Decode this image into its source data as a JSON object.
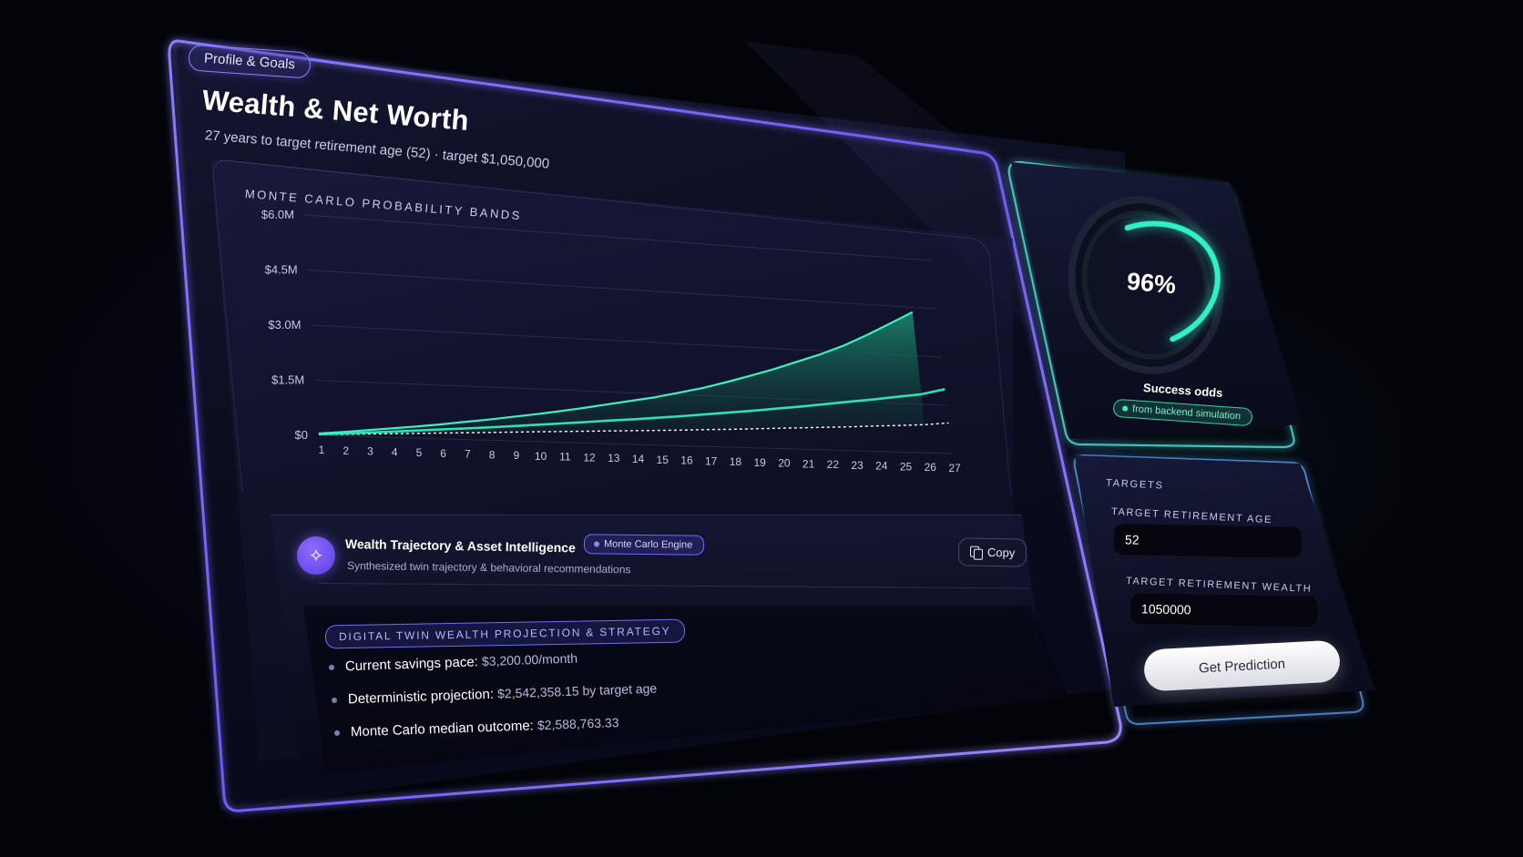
{
  "header": {
    "section_pill": "Profile & Goals",
    "title": "Wealth & Net Worth",
    "subtitle": "27 years to target retirement age (52) · target $1,050,000"
  },
  "chart_data": {
    "type": "area",
    "title": "Monte Carlo Probability Bands",
    "xlabel": "",
    "ylabel": "",
    "x": [
      1,
      2,
      3,
      4,
      5,
      6,
      7,
      8,
      9,
      10,
      11,
      12,
      13,
      14,
      15,
      16,
      17,
      18,
      19,
      20,
      21,
      22,
      23,
      24,
      25,
      26,
      27
    ],
    "y_tick_labels": [
      "$0",
      "$1.5M",
      "$3.0M",
      "$4.5M",
      "$6.0M"
    ],
    "ylim": [
      0,
      6000000
    ],
    "grid": true,
    "series": [
      {
        "values": [
          50000,
          110000,
          180000,
          250000,
          320000,
          400000,
          490000,
          580000,
          680000,
          780000,
          890000,
          1010000,
          1140000,
          1270000,
          1400000,
          1560000,
          1730000,
          1930000,
          2150000,
          2380000,
          2640000,
          2900000,
          3200000,
          3560000,
          3950000,
          4350000
        ]
      },
      {
        "values": [
          30000,
          70000,
          110000,
          160000,
          210000,
          260000,
          310000,
          360000,
          420000,
          480000,
          540000,
          600000,
          670000,
          730000,
          800000,
          870000,
          950000,
          1030000,
          1110000,
          1200000,
          1290000,
          1390000,
          1490000,
          1590000,
          1700000,
          1810000,
          2000000
        ]
      },
      {
        "values": [
          20000,
          45000,
          75000,
          100000,
          130000,
          160000,
          190000,
          220000,
          250000,
          280000,
          310000,
          340000,
          370000,
          400000,
          430000,
          460000,
          500000,
          530000,
          570000,
          610000,
          650000,
          690000,
          730000,
          780000,
          820000,
          870000,
          950000
        ]
      }
    ],
    "colors": {
      "upper": "#3df0c0",
      "median": "#2fe0b4",
      "baseline": "#ffffff",
      "fill": "#12634f"
    }
  },
  "insight": {
    "title": "Wealth Trajectory & Asset Intelligence",
    "badge": "Monte Carlo Engine",
    "subtitle": "Synthesized twin trajectory & behavioral recommendations",
    "copy_label": "Copy",
    "strategy_pill": "Digital Twin Wealth Projection & Strategy",
    "bullets": [
      {
        "label": "Current savings pace:",
        "value": "$3,200.00/month"
      },
      {
        "label": "Deterministic projection:",
        "value": "$2,542,358.15 by target age"
      },
      {
        "label": "Monte Carlo median outcome:",
        "value": "$2,588,763.33"
      }
    ]
  },
  "success": {
    "percent_label": "96%",
    "percent": 96,
    "label": "Success odds",
    "badge": "from backend simulation",
    "ring_color": "#2ff0c8"
  },
  "targets": {
    "title": "TARGETS",
    "age_label": "TARGET RETIREMENT AGE",
    "age_value": "52",
    "wealth_label": "TARGET RETIREMENT WEALTH",
    "wealth_value": "1050000",
    "button_label": "Get Prediction"
  },
  "theme": {
    "accent": "#7a6bff",
    "teal": "#2ff0c8",
    "background": "#03040a"
  }
}
